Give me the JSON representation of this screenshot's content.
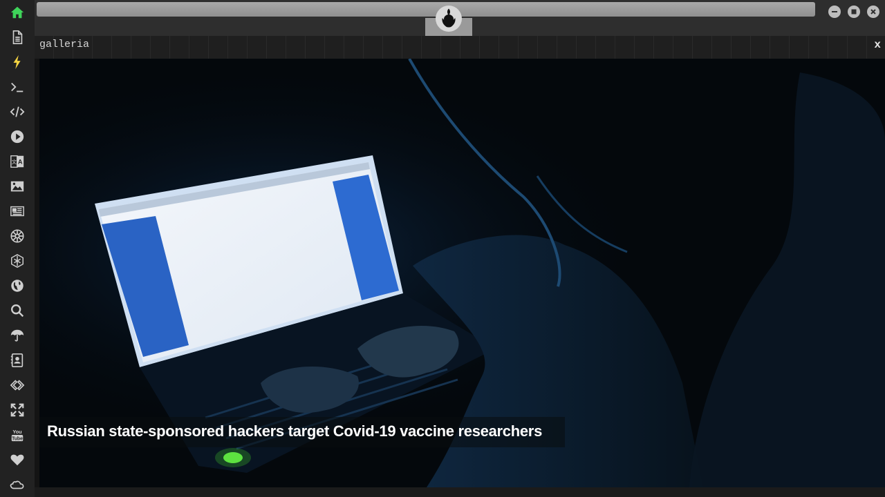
{
  "sidebar": {
    "items": [
      {
        "name": "home",
        "icon": "home-icon",
        "color": "#3fd45a"
      },
      {
        "name": "document",
        "icon": "document-icon",
        "color": "#cfcfcf"
      },
      {
        "name": "lightning",
        "icon": "lightning-icon",
        "color": "#f5d442"
      },
      {
        "name": "terminal",
        "icon": "terminal-icon",
        "color": "#cfcfcf"
      },
      {
        "name": "code",
        "icon": "code-icon",
        "color": "#cfcfcf"
      },
      {
        "name": "play",
        "icon": "play-icon",
        "color": "#cfcfcf"
      },
      {
        "name": "translate",
        "icon": "translate-icon",
        "color": "#cfcfcf"
      },
      {
        "name": "image",
        "icon": "image-icon",
        "color": "#cfcfcf"
      },
      {
        "name": "news",
        "icon": "newspaper-icon",
        "color": "#cfcfcf"
      },
      {
        "name": "empire",
        "icon": "empire-icon",
        "color": "#cfcfcf"
      },
      {
        "name": "hexagon",
        "icon": "hexagon-icon",
        "color": "#cfcfcf"
      },
      {
        "name": "globe",
        "icon": "globe-icon",
        "color": "#cfcfcf"
      },
      {
        "name": "search",
        "icon": "search-icon",
        "color": "#cfcfcf"
      },
      {
        "name": "umbrella",
        "icon": "umbrella-icon",
        "color": "#cfcfcf"
      },
      {
        "name": "contacts",
        "icon": "address-book-icon",
        "color": "#cfcfcf"
      },
      {
        "name": "link",
        "icon": "link-icon",
        "color": "#cfcfcf"
      },
      {
        "name": "expand",
        "icon": "expand-icon",
        "color": "#cfcfcf"
      },
      {
        "name": "youtube",
        "icon": "youtube-icon",
        "color": "#cfcfcf"
      },
      {
        "name": "heart",
        "icon": "heart-icon",
        "color": "#cfcfcf"
      },
      {
        "name": "cloud",
        "icon": "cloud-icon",
        "color": "#cfcfcf"
      }
    ]
  },
  "topbar": {
    "logo_icon": "rebel-alliance-logo-icon",
    "window_buttons": [
      "minimize-icon",
      "maximize-icon",
      "close-icon"
    ]
  },
  "panel": {
    "title": "galleria",
    "close_label": "x"
  },
  "gallery": {
    "caption": "Russian state-sponsored hackers target Covid-19 vaccine researchers"
  },
  "colors": {
    "accent_green": "#3fd45a",
    "accent_yellow": "#f5d442",
    "screen_blue": "#2f6fd0"
  }
}
